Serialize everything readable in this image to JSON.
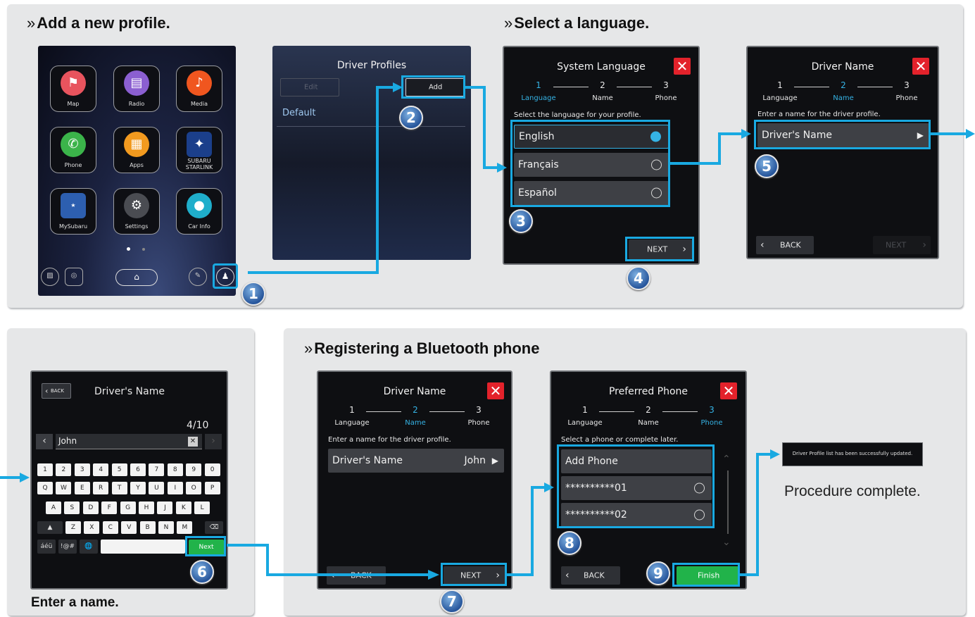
{
  "sections": {
    "add_profile": "Add a new profile.",
    "select_language": "Select a language.",
    "bluetooth": "Registering a Bluetooth phone",
    "enter_name": "Enter a name.",
    "chevron": "»"
  },
  "steps": [
    "1",
    "2",
    "3",
    "4",
    "5",
    "6",
    "7",
    "8",
    "9"
  ],
  "home": {
    "apps": [
      "Map",
      "Radio",
      "Media",
      "Phone",
      "Apps",
      "SUBARU STARLINK",
      "Car Info",
      "MySubaru",
      "Settings"
    ],
    "starlink_line1": "SUBARU",
    "starlink_line2": "STARLINK"
  },
  "profiles": {
    "title": "Driver Profiles",
    "edit": "Edit",
    "add": "Add",
    "default": "Default"
  },
  "language_screen": {
    "title": "System Language",
    "steps": [
      {
        "num": "1",
        "label": "Language"
      },
      {
        "num": "2",
        "label": "Name"
      },
      {
        "num": "3",
        "label": "Phone"
      }
    ],
    "instruction": "Select the language for your profile.",
    "options": [
      "English",
      "Français",
      "Español"
    ],
    "next": "NEXT"
  },
  "name_screen": {
    "title": "Driver Name",
    "instruction": "Enter a name for the driver profile.",
    "field": "Driver's Name",
    "back": "BACK",
    "next": "NEXT"
  },
  "keyboard_screen": {
    "back": "BACK",
    "title": "Driver's Name",
    "count": "4/10",
    "value": "John",
    "row1": [
      "1",
      "2",
      "3",
      "4",
      "5",
      "6",
      "7",
      "8",
      "9",
      "0"
    ],
    "row2": [
      "Q",
      "W",
      "E",
      "R",
      "T",
      "Y",
      "U",
      "I",
      "O",
      "P"
    ],
    "row3": [
      "A",
      "S",
      "D",
      "F",
      "G",
      "H",
      "J",
      "K",
      "L"
    ],
    "row4": [
      "Z",
      "X",
      "C",
      "V",
      "B",
      "N",
      "M"
    ],
    "accents": "áéü",
    "symbols": "!@#",
    "next": "Next"
  },
  "name_filled_screen": {
    "title": "Driver Name",
    "instruction": "Enter a name for the driver profile.",
    "field": "Driver's Name",
    "value": "John",
    "back": "BACK",
    "next": "NEXT"
  },
  "phone_screen": {
    "title": "Preferred Phone",
    "instruction": "Select a phone or complete later.",
    "add_phone": "Add Phone",
    "phones": [
      "**********01",
      "**********02"
    ],
    "back": "BACK",
    "finish": "Finish"
  },
  "completion": {
    "message": "Driver Profile list has been successfully updated.",
    "caption": "Procedure complete."
  },
  "colors": {
    "highlight": "#19a9e1",
    "accent": "#35b3e5",
    "close": "#e3222b",
    "finish": "#21b34a",
    "panel": "#e6e7e8"
  }
}
